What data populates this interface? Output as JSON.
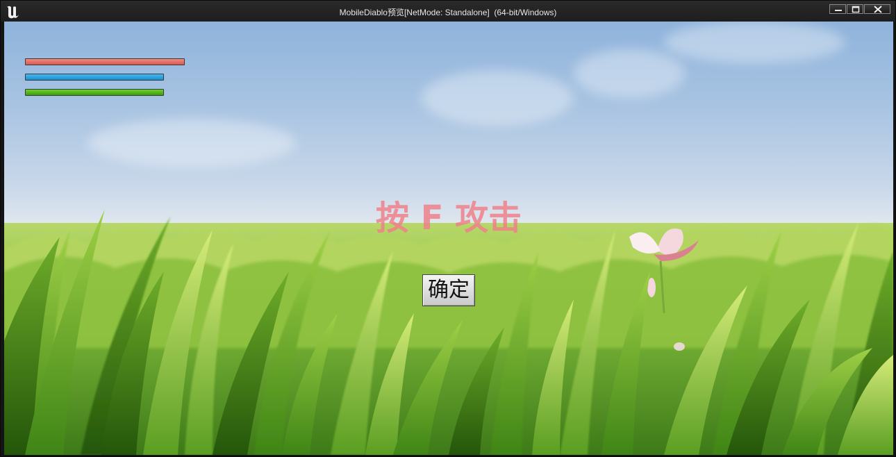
{
  "window": {
    "title": "MobileDiablo预览[NetMode: Standalone]  (64-bit/Windows)",
    "logo": "unreal-engine-logo"
  },
  "window_controls": {
    "minimize_icon": "minimize-icon",
    "maximize_icon": "maximize-icon",
    "close_icon": "close-icon"
  },
  "hud": {
    "health": {
      "color": "#e06a60",
      "fill_percent": 100
    },
    "mana": {
      "color": "#1b9be0",
      "fill_percent": 100
    },
    "stamina": {
      "color": "#4cb318",
      "fill_percent": 100
    }
  },
  "prompt": {
    "text": "按 F 攻击",
    "color": "#ee808a"
  },
  "confirm_button": {
    "label": "确定"
  },
  "scene": {
    "sky_color": "#a9c4e2",
    "grass_color": "#5fa52a",
    "flower_color": "#e8a9b4"
  }
}
